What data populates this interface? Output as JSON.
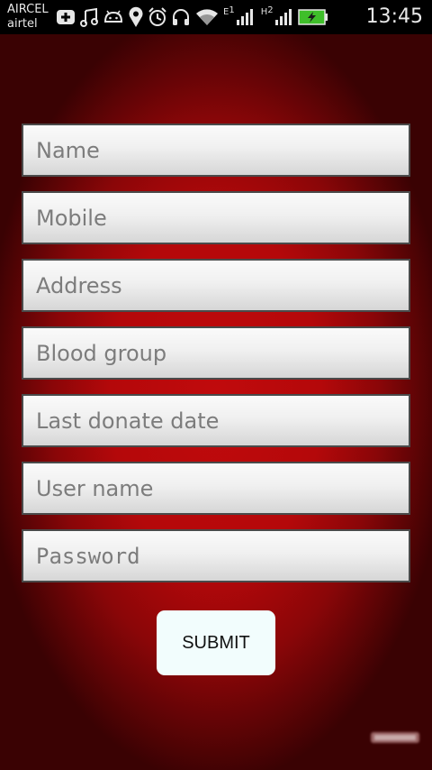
{
  "status_bar": {
    "carrier_1": "AIRCEL",
    "carrier_2": "airtel",
    "network_1_type": "E",
    "network_1_sim": "1",
    "network_2_type": "H",
    "network_2_sim": "2",
    "time": "13:45",
    "icons": [
      "add-icon",
      "music-icon",
      "android-icon",
      "location-icon",
      "alarm-icon",
      "headphones-icon",
      "wifi-icon",
      "signal-icon",
      "signal-icon",
      "battery-charging-icon"
    ],
    "battery_color": "#3fbf2a"
  },
  "form": {
    "fields": [
      {
        "name": "name",
        "placeholder": "Name",
        "value": ""
      },
      {
        "name": "mobile",
        "placeholder": "Mobile",
        "value": ""
      },
      {
        "name": "address",
        "placeholder": "Address",
        "value": ""
      },
      {
        "name": "blood-group",
        "placeholder": "Blood group",
        "value": ""
      },
      {
        "name": "last-donate-date",
        "placeholder": "Last donate date",
        "value": ""
      },
      {
        "name": "user-name",
        "placeholder": "User name",
        "value": ""
      },
      {
        "name": "password",
        "placeholder": "Password",
        "value": ""
      }
    ],
    "submit_label": "SUBMIT"
  },
  "colors": {
    "background_red": "#c00a0c",
    "submit_background": "#f2fdfd"
  }
}
